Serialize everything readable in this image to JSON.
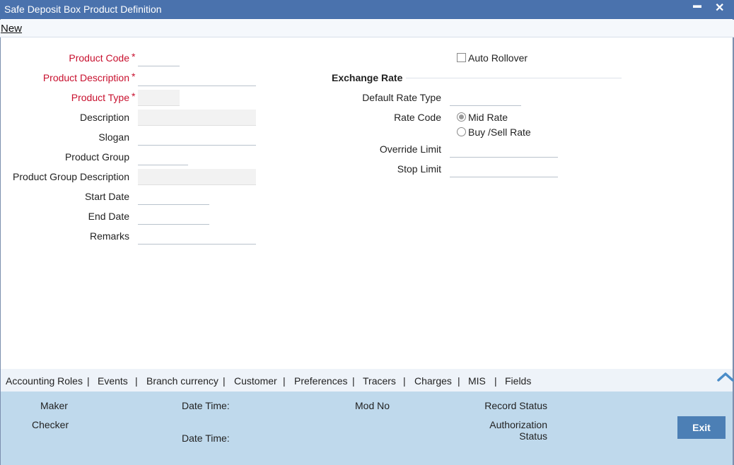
{
  "window": {
    "title": "Safe Deposit Box Product Definition",
    "minimize": "▬",
    "close": "✕"
  },
  "toolbar": {
    "new_label": "New"
  },
  "form": {
    "product_code": {
      "label": "Product Code",
      "required": "*",
      "value": ""
    },
    "product_description": {
      "label": "Product Description",
      "required": "*",
      "value": ""
    },
    "product_type": {
      "label": "Product Type",
      "required": "*",
      "value": ""
    },
    "description": {
      "label": "Description",
      "value": ""
    },
    "slogan": {
      "label": "Slogan",
      "value": ""
    },
    "product_group": {
      "label": "Product Group",
      "value": ""
    },
    "product_group_description": {
      "label": "Product Group Description",
      "value": ""
    },
    "start_date": {
      "label": "Start Date",
      "value": ""
    },
    "end_date": {
      "label": "End Date",
      "value": ""
    },
    "remarks": {
      "label": "Remarks",
      "value": ""
    },
    "auto_rollover": {
      "label": "Auto Rollover",
      "checked": false
    }
  },
  "exchange_rate": {
    "title": "Exchange Rate",
    "default_rate_type": {
      "label": "Default Rate Type",
      "value": ""
    },
    "rate_code": {
      "label": "Rate Code",
      "options": [
        {
          "label": "Mid Rate",
          "selected": true
        },
        {
          "label": "Buy /Sell Rate",
          "selected": false
        }
      ]
    },
    "override_limit": {
      "label": "Override Limit",
      "value": ""
    },
    "stop_limit": {
      "label": "Stop Limit",
      "value": ""
    }
  },
  "tabs": [
    "Accounting Roles",
    "Events",
    "Branch currency",
    "Customer",
    "Preferences",
    "Tracers",
    "Charges",
    "MIS",
    "Fields"
  ],
  "tab_separator": "|",
  "footer": {
    "maker": "Maker",
    "checker": "Checker",
    "date_time_1": "Date Time:",
    "date_time_2": "Date Time:",
    "mod_no": "Mod No",
    "record_status": "Record Status",
    "authorization_status_line1": "Authorization",
    "authorization_status_line2": "Status",
    "exit_label": "Exit"
  },
  "colors": {
    "title_bar": "#4a72ad",
    "required_label": "#c8102e",
    "footer_bg": "#bfd9ec",
    "exit_button": "#4c7fb5"
  }
}
